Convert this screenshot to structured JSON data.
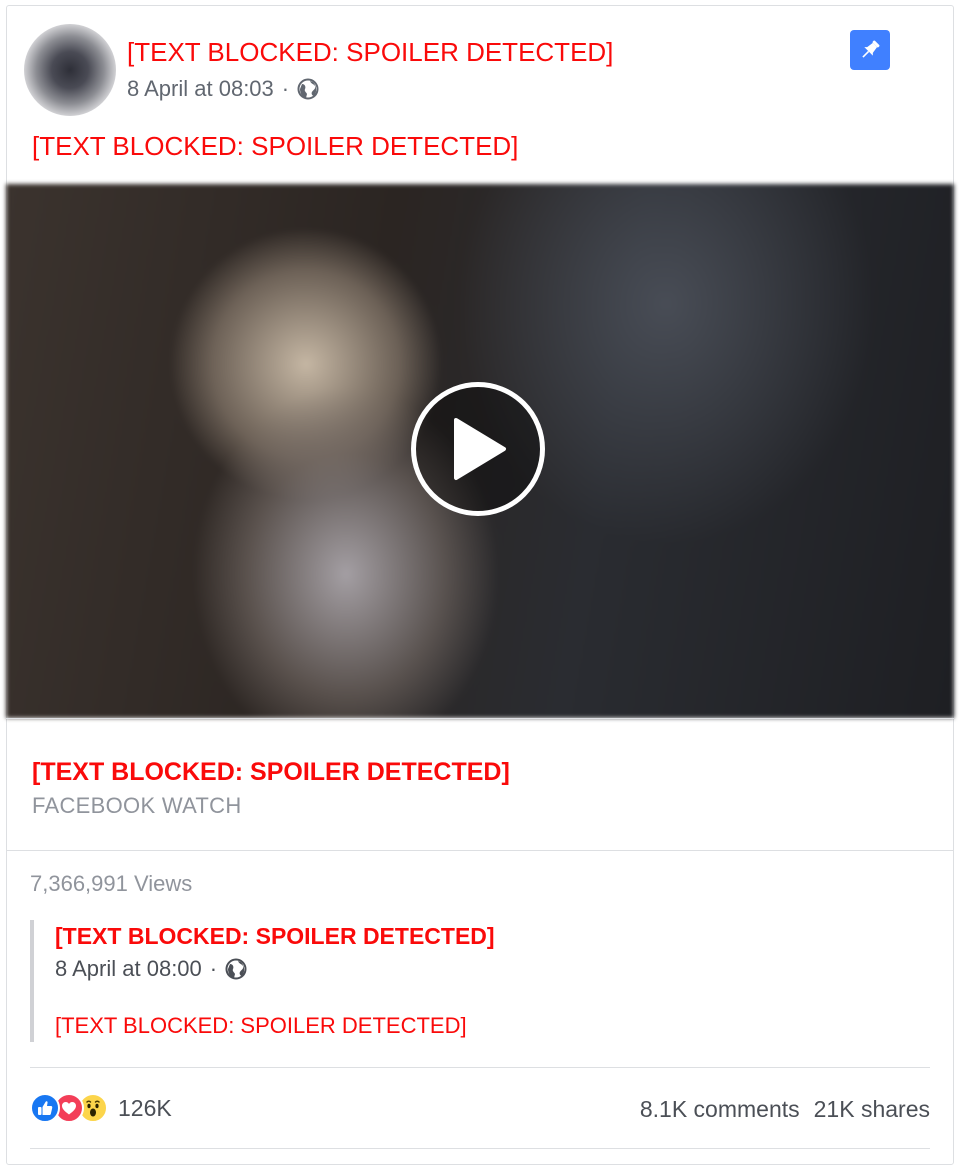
{
  "post": {
    "author": "[TEXT BLOCKED: SPOILER DETECTED]",
    "timestamp": "8 April at 08:03",
    "separator": "·",
    "audience_icon": "globe-icon",
    "text": "[TEXT BLOCKED: SPOILER DETECTED]",
    "pin_icon": "pin-icon"
  },
  "video": {
    "play_icon": "play-icon"
  },
  "link": {
    "title": "[TEXT BLOCKED: SPOILER DETECTED]",
    "source": "FACEBOOK WATCH"
  },
  "views": "7,366,991 Views",
  "shared_post": {
    "author": "[TEXT BLOCKED: SPOILER DETECTED]",
    "timestamp": "8 April at 08:00",
    "separator": "·",
    "text": "[TEXT BLOCKED: SPOILER DETECTED]"
  },
  "footer": {
    "reactions": [
      "like",
      "love",
      "wow"
    ],
    "reaction_count": "126K",
    "comments": "8.1K comments",
    "shares": "21K shares"
  },
  "colors": {
    "blocked_text": "#fa0a0a",
    "pin_background": "#4080ff",
    "muted_text": "#90949c",
    "like": "#1877f2",
    "love": "#f33e58",
    "wow": "#fcd54b"
  }
}
